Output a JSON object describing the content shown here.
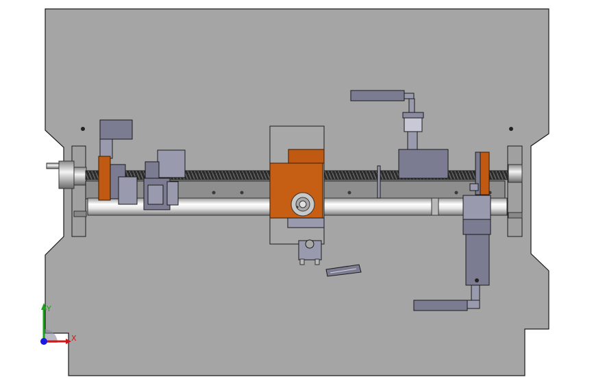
{
  "viewport": {
    "background": "#ffffff",
    "plate_color": "#a5a5a5",
    "outline_color": "#1a1a1a"
  },
  "colors": {
    "part_gray": "#7b7b92",
    "part_light": "#9a9aaf",
    "orange": "#c05a12",
    "orange_light": "#d56a1e",
    "shaft_light": "#ffffff",
    "shaft_dark": "#8a8a8a",
    "rail_dark": "#4a4a4a"
  },
  "triad": {
    "y_label": "Y",
    "x_label": "X",
    "y_color": "#19a319",
    "x_color": "#d01818",
    "z_color": "#1a1ae0"
  }
}
